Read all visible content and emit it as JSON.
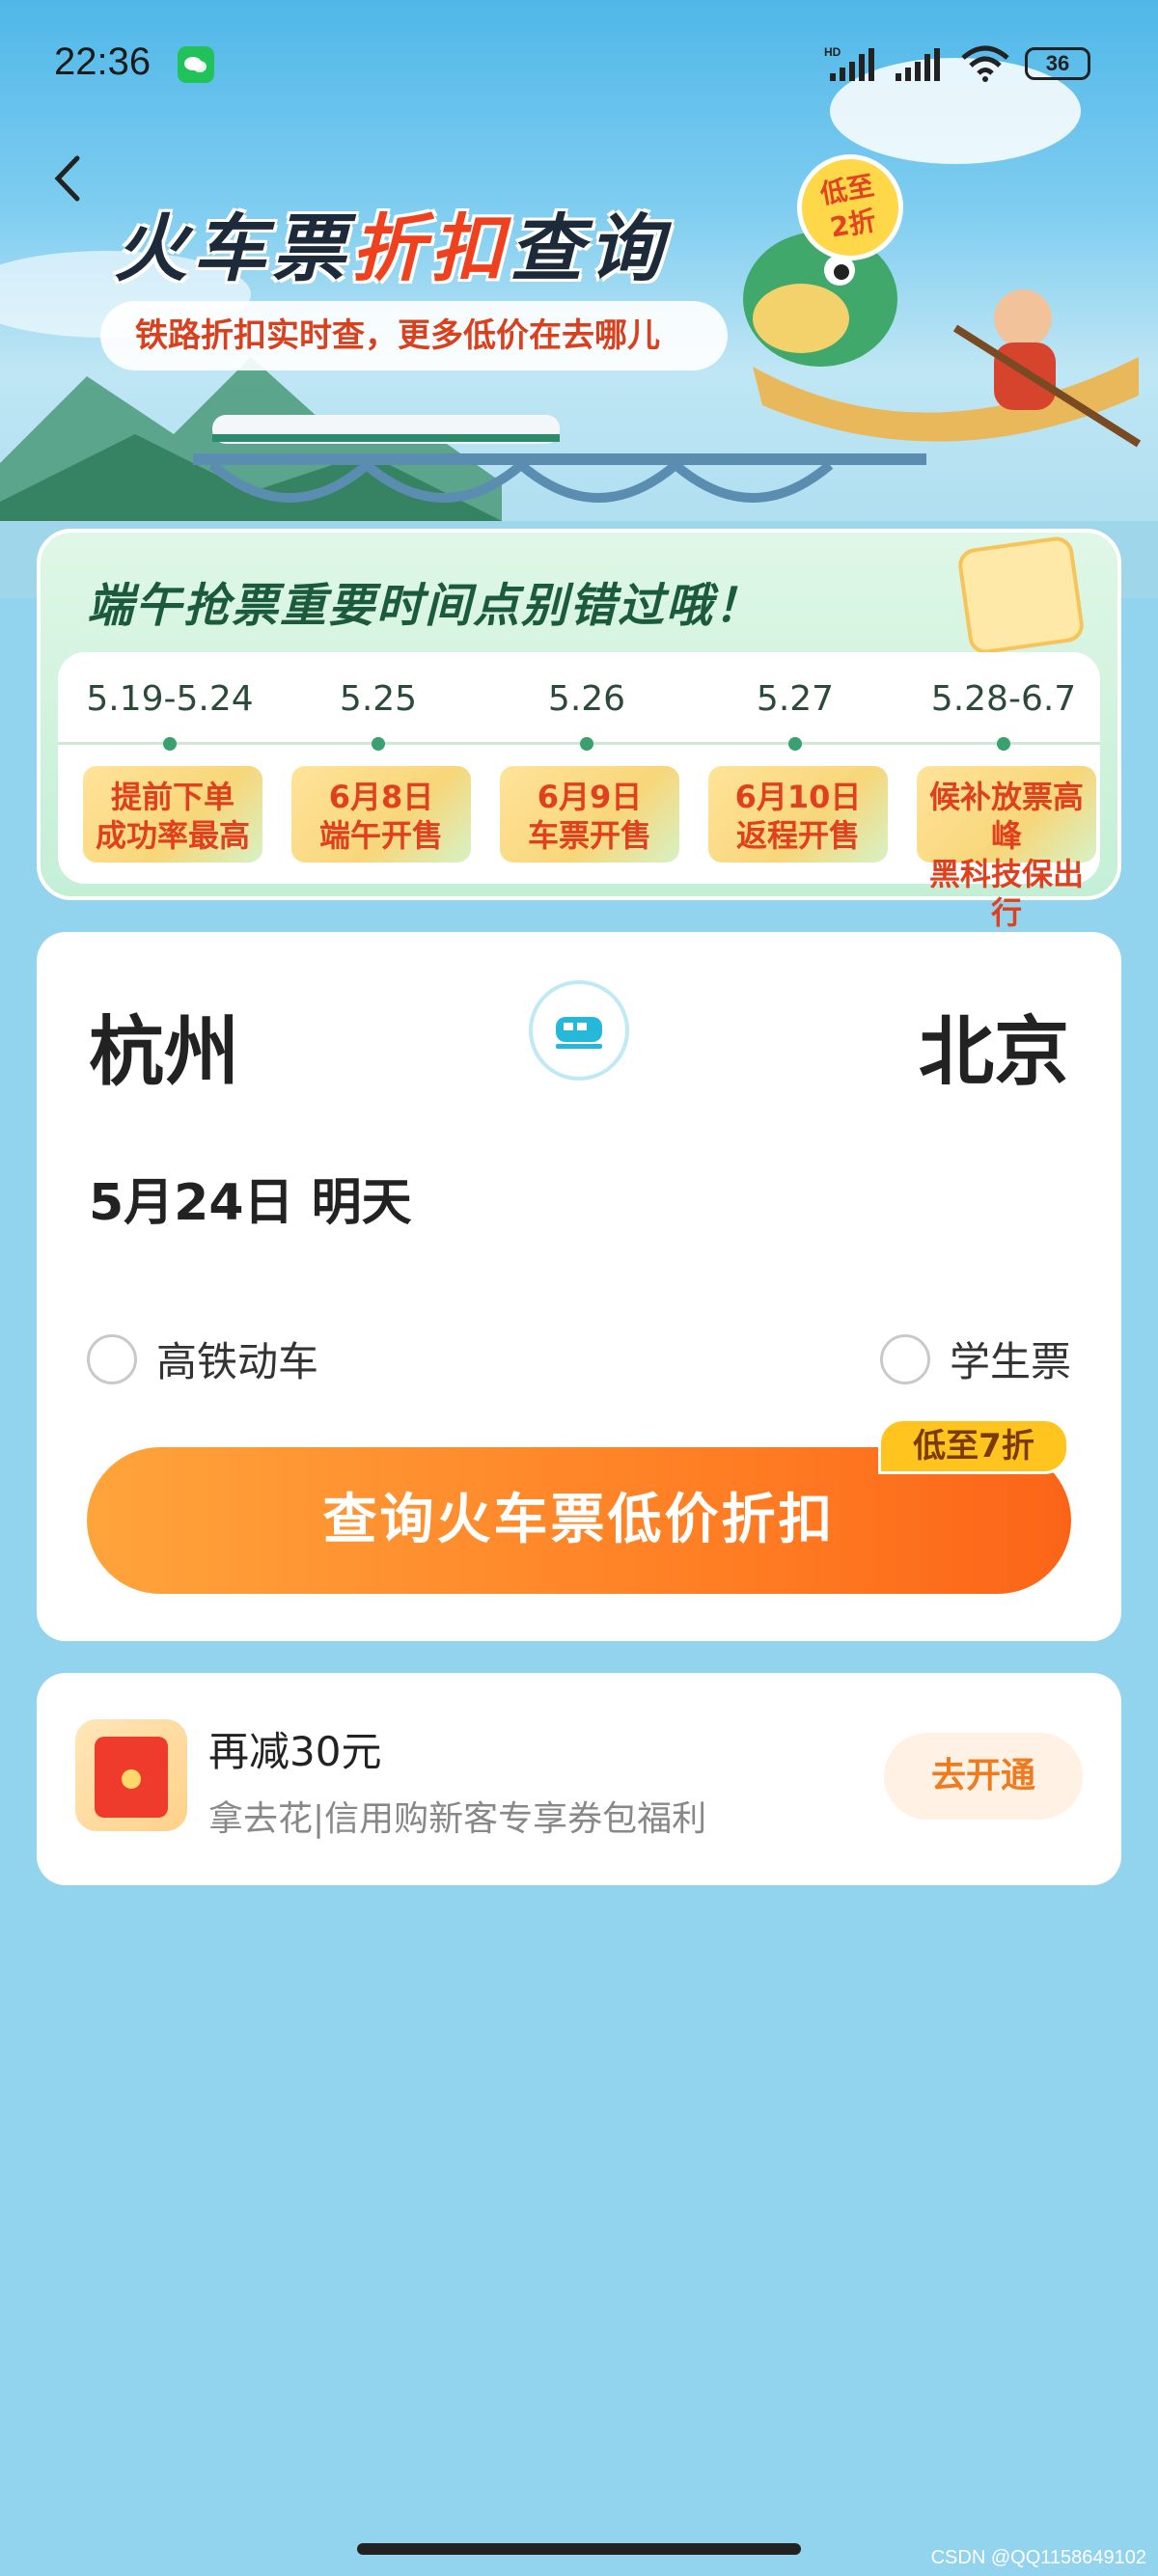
{
  "status_bar": {
    "time": "22:36",
    "battery": "36",
    "network_label": "HD"
  },
  "hero": {
    "title_part1": "火车票",
    "title_highlight": "折扣",
    "title_part2": "查询",
    "subtitle": "铁路折扣实时查，更多低价在去哪儿",
    "badge_line1": "低至",
    "badge_line2": "2折"
  },
  "dragon_boat": {
    "title": "端午抢票重要时间点别错过哦！",
    "timeline": [
      {
        "date": "5.19-5.24",
        "line1": "提前下单",
        "line2": "成功率最高"
      },
      {
        "date": "5.25",
        "line1": "6月8日",
        "line2": "端午开售"
      },
      {
        "date": "5.26",
        "line1": "6月9日",
        "line2": "车票开售"
      },
      {
        "date": "5.27",
        "line1": "6月10日",
        "line2": "返程开售"
      },
      {
        "date": "5.28-6.7",
        "line1": "候补放票高峰",
        "line2": "黑科技保出行"
      }
    ]
  },
  "search": {
    "from_city": "杭州",
    "to_city": "北京",
    "date": "5月24日 明天",
    "option_highspeed": "高铁动车",
    "option_student": "学生票",
    "query_button": "查询火车票低价折扣",
    "query_tag": "低至7折"
  },
  "coupon": {
    "title": "再减30元",
    "description": "拿去花|信用购新客专享券包福利",
    "button": "去开通"
  },
  "footer": {
    "watermark": "CSDN @QQ1158649102"
  },
  "colors": {
    "accent_orange": "#ff7a22",
    "title_red": "#f0411f",
    "page_bg": "#92d3ee"
  }
}
